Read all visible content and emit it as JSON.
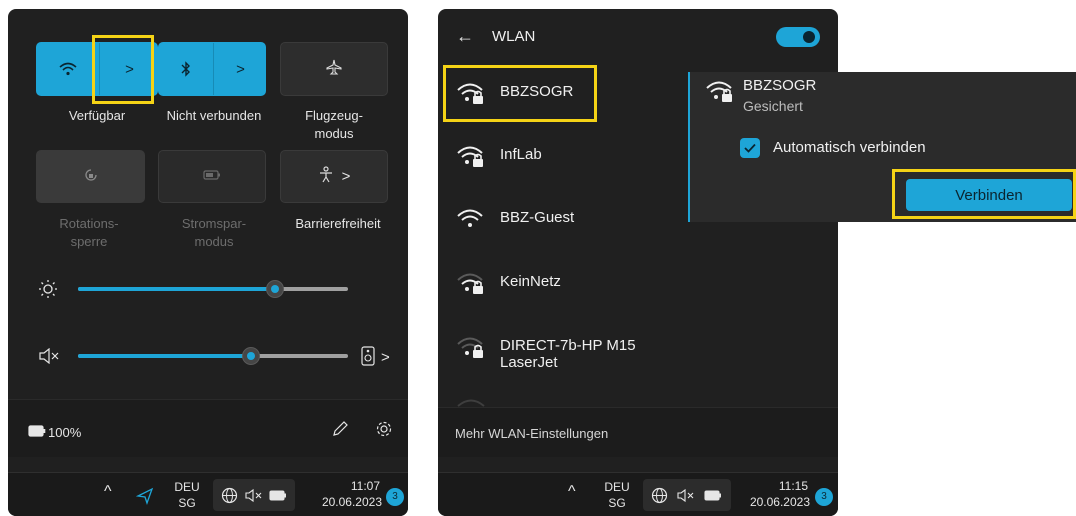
{
  "colors": {
    "accent": "#1ea5d7",
    "panel_bg": "#202020",
    "highlight": "#f5d316"
  },
  "quick_settings": {
    "tiles": [
      {
        "label": "Verfügbar",
        "icon": "wifi-icon",
        "active": true,
        "chevron": ">"
      },
      {
        "label": "Nicht verbunden",
        "icon": "bluetooth-icon",
        "active": true,
        "chevron": ">"
      },
      {
        "label": "Flugzeug-\nmodus",
        "icon": "airplane-icon",
        "active": false
      },
      {
        "label": "Rotations-\nsperre",
        "icon": "rotation-lock-icon",
        "disabled": true
      },
      {
        "label": "Stromspar-\nmodus",
        "icon": "battery-saver-icon",
        "disabled": true
      },
      {
        "label": "Barrierefreiheit",
        "icon": "accessibility-icon",
        "chevron": ">"
      }
    ],
    "brightness_level": 0.73,
    "volume_level": 0.64,
    "volume_chevron": ">",
    "battery_text": "100%"
  },
  "taskbar_left": {
    "chevron": "^",
    "lang_top": "DEU",
    "lang_bottom": "SG",
    "time": "11:07",
    "date": "20.06.2023",
    "notifications": "3"
  },
  "wlan": {
    "back_arrow": "←",
    "title": "WLAN",
    "toggle_on": true,
    "networks": [
      {
        "name": "BBZSOGR",
        "secured": true,
        "signal": 4
      },
      {
        "name": "InfLab",
        "secured": true,
        "signal": 4
      },
      {
        "name": "BBZ-Guest",
        "secured": false,
        "signal": 4
      },
      {
        "name": "KeinNetz",
        "secured": true,
        "signal": 3
      },
      {
        "name": "DIRECT-7b-HP M15 LaserJet",
        "secured": true,
        "signal": 2
      }
    ],
    "more_settings": "Mehr WLAN-Einstellungen"
  },
  "popup": {
    "network_name": "BBZSOGR",
    "status": "Gesichert",
    "auto_connect_label": "Automatisch verbinden",
    "auto_connect_checked": true,
    "connect_button": "Verbinden"
  },
  "taskbar_right": {
    "chevron": "^",
    "lang_top": "DEU",
    "lang_bottom": "SG",
    "time": "11:15",
    "date": "20.06.2023",
    "notifications": "3"
  }
}
